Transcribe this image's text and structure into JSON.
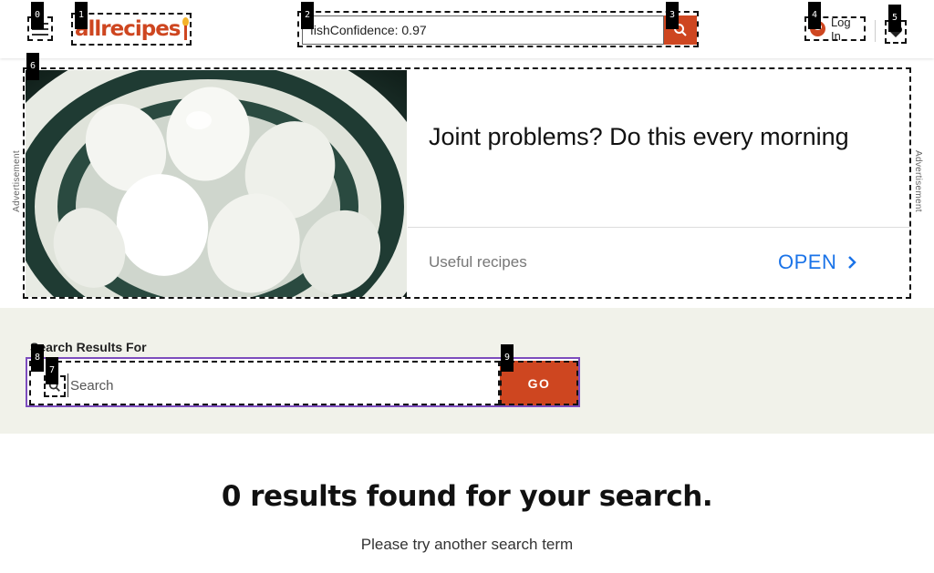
{
  "header": {
    "logo_text": "allrecipes",
    "search_value": "fishConfidence: 0.97",
    "login_label": "Log In"
  },
  "ad": {
    "side_label": "Advertisement",
    "headline": "Joint problems? Do this every morning",
    "source": "Useful recipes",
    "cta": "OPEN"
  },
  "results": {
    "label": "Search Results For",
    "placeholder": "Search",
    "go_label": "GO",
    "heading": "0 results found for your search.",
    "subtext": "Please try another search term"
  },
  "markers": [
    "0",
    "1",
    "2",
    "3",
    "4",
    "5",
    "6",
    "7",
    "8",
    "9"
  ],
  "colors": {
    "brand": "#ce4620",
    "focus_outline": "#7c4dbd",
    "band_background": "#f1f2ea",
    "ad_link": "#1a73e8"
  },
  "icons": [
    "hamburger-menu-icon",
    "search-icon",
    "user-icon",
    "heart-icon",
    "chevron-right-icon"
  ]
}
